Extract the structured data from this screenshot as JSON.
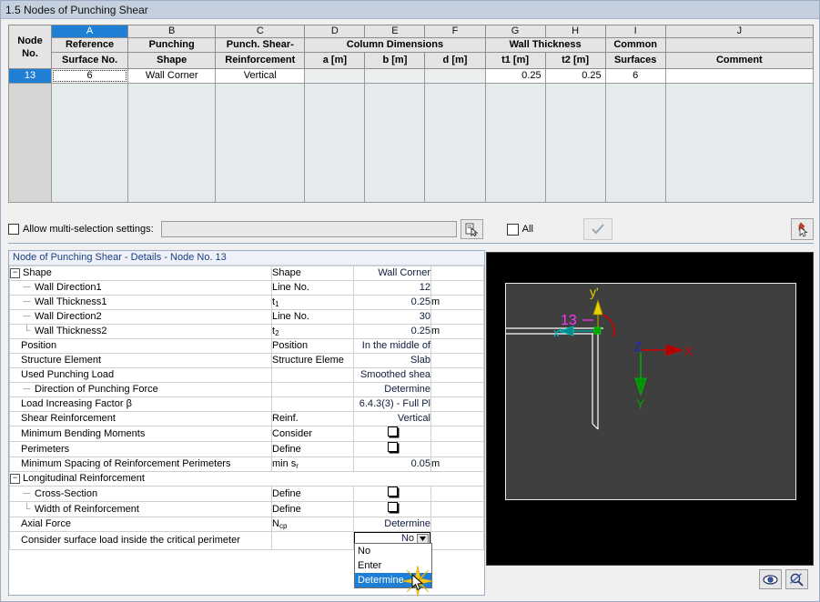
{
  "window": {
    "title": "1.5 Nodes of Punching Shear"
  },
  "table": {
    "letters": [
      "A",
      "B",
      "C",
      "D",
      "E",
      "F",
      "G",
      "H",
      "I",
      "J"
    ],
    "selected_letter": "A",
    "index_header": [
      "Node",
      "No."
    ],
    "headers": [
      {
        "top": "Reference",
        "bottom": "Surface No."
      },
      {
        "top": "Punching",
        "bottom": "Shape"
      },
      {
        "top": "Punch. Shear-",
        "bottom": "Reinforcement"
      },
      {
        "top": "",
        "bottom": "a [m]"
      },
      {
        "top": "",
        "bottom": "b [m]"
      },
      {
        "top": "",
        "bottom": "d [m]"
      },
      {
        "top": "",
        "bottom": "t1 [m]"
      },
      {
        "top": "",
        "bottom": "t2 [m]"
      },
      {
        "top": "Common",
        "bottom": "Surfaces"
      },
      {
        "top": "",
        "bottom": "Comment"
      }
    ],
    "group_headers": [
      {
        "label": "Column Dimensions",
        "span": 3
      },
      {
        "label": "Wall Thickness",
        "span": 2
      }
    ],
    "rows": [
      {
        "index": "13",
        "cells": [
          "6",
          "Wall Corner",
          "Vertical",
          "",
          "",
          "",
          "0.25",
          "0.25",
          "6",
          ""
        ]
      }
    ]
  },
  "multiselect": {
    "checkbox_label": "Allow multi-selection settings:",
    "field_value": "",
    "all_label": "All",
    "pick_button": "pick-button",
    "ok_button": "ok-button",
    "right_button": "select-in-graphic-button"
  },
  "details": {
    "header": "Node of Punching Shear - Details - Node No.  13",
    "rows": [
      {
        "kind": "group",
        "label": "Shape",
        "symbol": "Shape",
        "value": "Wall Corner",
        "unit": ""
      },
      {
        "kind": "child",
        "label": "Wall Direction1",
        "symbol": "Line No.",
        "value": "12",
        "unit": ""
      },
      {
        "kind": "child",
        "label": "Wall Thickness1",
        "symbol": "t1",
        "symbol_sub": "1",
        "symbol_base": "t",
        "value": "0.25",
        "unit": "m"
      },
      {
        "kind": "child",
        "label": "Wall Direction2",
        "symbol": "Line No.",
        "value": "30",
        "unit": ""
      },
      {
        "kind": "childlast",
        "label": "Wall Thickness2",
        "symbol": "t2",
        "symbol_sub": "2",
        "symbol_base": "t",
        "value": "0.25",
        "unit": "m"
      },
      {
        "kind": "item",
        "label": "Position",
        "symbol": "Position",
        "value": "In the middle of",
        "unit": ""
      },
      {
        "kind": "item",
        "label": "Structure Element",
        "symbol": "Structure Eleme",
        "value": "Slab",
        "unit": ""
      },
      {
        "kind": "item",
        "label": "Used Punching Load",
        "symbol": "",
        "value": "Smoothed shea",
        "unit": ""
      },
      {
        "kind": "child",
        "label": "Direction of Punching Force",
        "symbol": "",
        "value": "Determine",
        "unit": ""
      },
      {
        "kind": "item",
        "label": "Load Increasing Factor β",
        "symbol": "",
        "value": "6.4.3(3) - Full Pl",
        "unit": ""
      },
      {
        "kind": "item",
        "label": "Shear Reinforcement",
        "symbol": "Reinf.",
        "value": "Vertical",
        "unit": ""
      },
      {
        "kind": "item",
        "label": "Minimum Bending Moments",
        "symbol": "Consider",
        "value": "__CHECKBOX__",
        "unit": ""
      },
      {
        "kind": "item",
        "label": "Perimeters",
        "symbol": "Define",
        "value": "__CHECKBOX__",
        "unit": ""
      },
      {
        "kind": "item",
        "label": "Minimum Spacing of Reinforcement Perimeters",
        "symbol": "min sr",
        "symbol_sub": "r",
        "symbol_base": "min s",
        "value": "0.05",
        "unit": "m"
      },
      {
        "kind": "group",
        "label": "Longitudinal Reinforcement",
        "symbol": "",
        "value": "",
        "unit": ""
      },
      {
        "kind": "child",
        "label": "Cross-Section",
        "symbol": "Define",
        "value": "__CHECKBOX__",
        "unit": ""
      },
      {
        "kind": "childlast",
        "label": "Width of Reinforcement",
        "symbol": "Define",
        "value": "__CHECKBOX__",
        "unit": ""
      },
      {
        "kind": "item",
        "label": "Axial Force",
        "symbol": "Ncp",
        "symbol_sub": "cp",
        "symbol_base": "N",
        "value": "Determine",
        "unit": ""
      },
      {
        "kind": "combo",
        "label": "Consider surface load inside the critical perimeter",
        "symbol": "",
        "value": "No",
        "unit": ""
      }
    ]
  },
  "dropdown": {
    "selected": "Determine",
    "options": [
      "No",
      "Enter",
      "Determine"
    ]
  },
  "viewport": {
    "node_label": "13",
    "local_axis_y_label": "y'",
    "local_axis_x_label": "x'",
    "global_axes": {
      "x": "X",
      "y": "Y",
      "z": "Z"
    },
    "colors": {
      "node_label": "#ff33ff",
      "local_y": "#e8d000",
      "local_x": "#00c8c8",
      "global_x": "#d40000",
      "global_y": "#00a800",
      "global_z": "#2020d0",
      "background": "#3f3f3f",
      "outer": "#000000",
      "wall_line": "#ffffff",
      "moment_arc": "#d40000"
    },
    "buttons": {
      "view_label": "eye-icon",
      "zoom_label": "zoom-icon"
    }
  },
  "theme": {
    "accent": "#1e7fd4",
    "title_bar": "#c4d0de",
    "panel_header_text": "#1b3f82"
  }
}
